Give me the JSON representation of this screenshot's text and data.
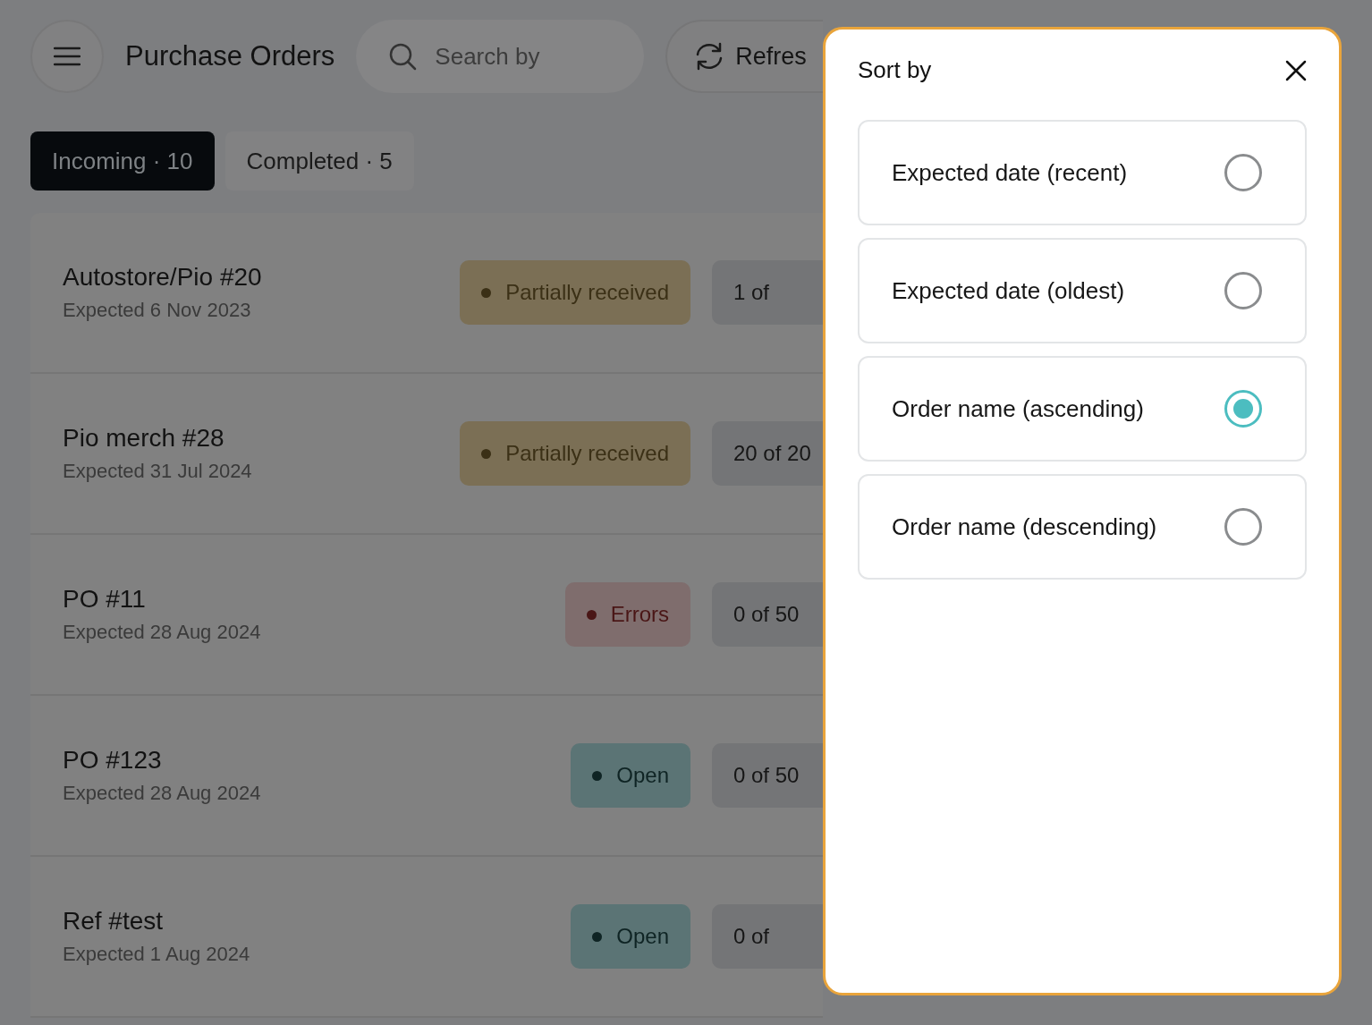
{
  "header": {
    "title": "Purchase Orders",
    "search": {
      "placeholder": "Search by"
    },
    "refresh_button": {
      "label": "Refres"
    }
  },
  "tabs": [
    {
      "label": "Incoming · 10",
      "selected": true
    },
    {
      "label": "Completed · 5",
      "selected": false
    }
  ],
  "orders": [
    {
      "name": "Autostore/Pio #20",
      "expected": "Expected 6 Nov 2023",
      "status": {
        "kind": "partial",
        "label": "Partially received"
      },
      "count": "1 of"
    },
    {
      "name": "Pio merch #28",
      "expected": "Expected 31 Jul 2024",
      "status": {
        "kind": "partial",
        "label": "Partially received"
      },
      "count": "20 of 20"
    },
    {
      "name": "PO #11",
      "expected": "Expected 28 Aug 2024",
      "status": {
        "kind": "errors",
        "label": "Errors"
      },
      "count": "0 of 50"
    },
    {
      "name": "PO #123",
      "expected": "Expected 28 Aug 2024",
      "status": {
        "kind": "open",
        "label": "Open"
      },
      "count": "0 of 50"
    },
    {
      "name": "Ref #test",
      "expected": "Expected 1 Aug 2024",
      "status": {
        "kind": "open",
        "label": "Open"
      },
      "count": "0 of"
    }
  ],
  "sort_panel": {
    "title": "Sort by",
    "options": [
      {
        "label": "Expected date (recent)",
        "selected": false
      },
      {
        "label": "Expected date (oldest)",
        "selected": false
      },
      {
        "label": "Order name (ascending)",
        "selected": true
      },
      {
        "label": "Order name (descending)",
        "selected": false
      }
    ]
  }
}
